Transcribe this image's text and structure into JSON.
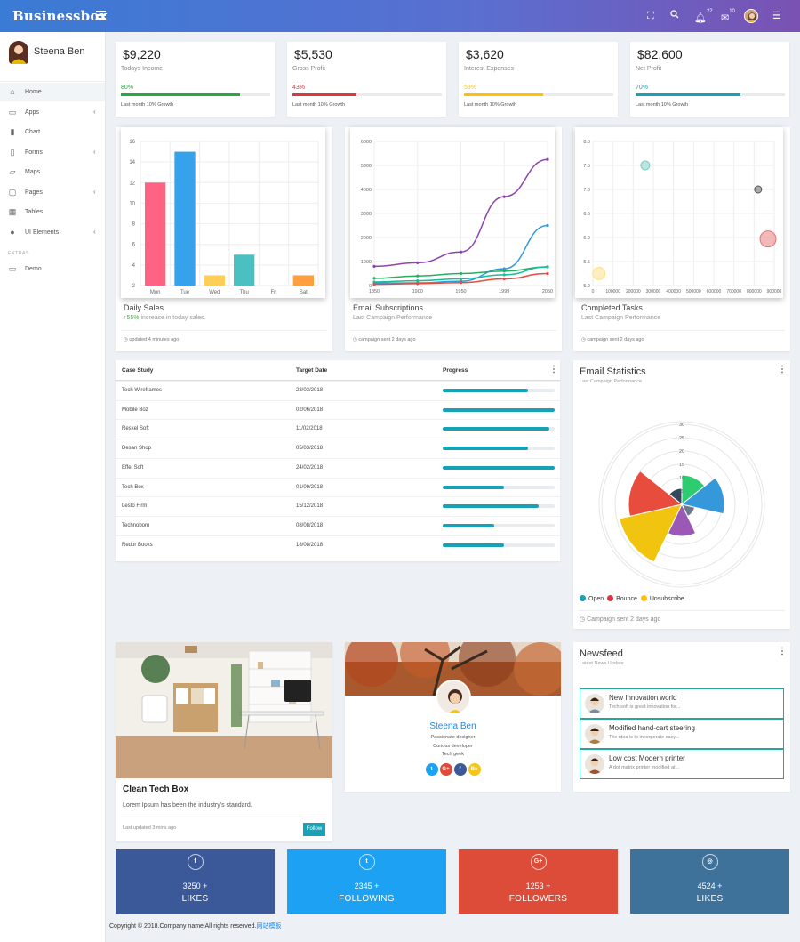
{
  "brand": "Businessbox",
  "topbar": {
    "notif_count": "22",
    "mail_count": "10"
  },
  "user": {
    "name": "Steena Ben"
  },
  "sidebar": {
    "items": [
      {
        "label": "Home",
        "icon": "home-icon",
        "glyph": "⌂",
        "chevron": false
      },
      {
        "label": "Apps",
        "icon": "apps-icon",
        "glyph": "▭",
        "chevron": true
      },
      {
        "label": "Chart",
        "icon": "chart-icon",
        "glyph": "▮",
        "chevron": false
      },
      {
        "label": "Forms",
        "icon": "forms-icon",
        "glyph": "▯",
        "chevron": true
      },
      {
        "label": "Maps",
        "icon": "maps-icon",
        "glyph": "▱",
        "chevron": false
      },
      {
        "label": "Pages",
        "icon": "pages-icon",
        "glyph": "▢",
        "chevron": true
      },
      {
        "label": "Tables",
        "icon": "tables-icon",
        "glyph": "▦",
        "chevron": false
      },
      {
        "label": "UI Elements",
        "icon": "ui-elements-icon",
        "glyph": "●",
        "chevron": true
      }
    ],
    "extras_label": "EXTRAS",
    "demo": "Demo"
  },
  "stats": [
    {
      "value": "$9,220",
      "label": "Todays Income",
      "pct": "80%",
      "fill": 0.8,
      "color": "#28a745",
      "note": "Last month 10% Growth"
    },
    {
      "value": "$5,530",
      "label": "Gross Profit",
      "pct": "43%",
      "fill": 0.43,
      "color": "#dc3545",
      "note": "Last month 10% Growth"
    },
    {
      "value": "$3,620",
      "label": "Interest Expenses",
      "pct": "53%",
      "fill": 0.53,
      "color": "#ffc107",
      "note": "Last month 10% Growth"
    },
    {
      "value": "$82,600",
      "label": "Net Profit",
      "pct": "70%",
      "fill": 0.7,
      "color": "#17a2b8",
      "note": "Last month 10% Growth"
    }
  ],
  "daily": {
    "title": "Daily Sales",
    "up": "55%",
    "sub": " increase in today sales.",
    "foot": "updated 4 minutes ago"
  },
  "email_sub": {
    "title": "Email Subscriptions",
    "sub": "Last Campaign Performance",
    "foot": "campaign sent 2 days ago"
  },
  "tasks": {
    "title": "Completed Tasks",
    "sub": "Last Campaign Performance",
    "foot": "campaign sent 2 days ago"
  },
  "chart_data": [
    {
      "type": "bar",
      "categories": [
        "Mon",
        "Tue",
        "Wed",
        "Thu",
        "Fri",
        "Sat"
      ],
      "values": [
        12,
        15,
        3,
        5,
        2,
        3
      ],
      "colors": [
        "#ff6384",
        "#36a2eb",
        "#ffce56",
        "#4bc0c0",
        "#9966ff",
        "#ff9f40"
      ],
      "ylim": [
        2,
        16
      ],
      "yticks": [
        "2",
        "4",
        "6",
        "8",
        "10",
        "12",
        "14",
        "16"
      ],
      "xlabel": "",
      "ylabel": "",
      "title": ""
    },
    {
      "type": "line",
      "x": [
        1850,
        1900,
        1950,
        1999,
        2050
      ],
      "xticks": [
        "1850",
        "1900",
        "1950",
        "1999",
        "2050"
      ],
      "ylim": [
        0,
        6000
      ],
      "yticks": [
        "0",
        "1000",
        "2000",
        "3000",
        "4000",
        "5000",
        "6000"
      ],
      "series": [
        {
          "values": [
            800,
            950,
            1400,
            3700,
            5250
          ],
          "color": "#8e44ad"
        },
        {
          "values": [
            100,
            110,
            180,
            700,
            2500
          ],
          "color": "#3498db"
        },
        {
          "values": [
            300,
            400,
            500,
            600,
            780
          ],
          "color": "#27ae60"
        },
        {
          "values": [
            150,
            200,
            280,
            450,
            780
          ],
          "color": "#1abc9c"
        },
        {
          "values": [
            50,
            80,
            120,
            280,
            500
          ],
          "color": "#e74c3c"
        }
      ]
    },
    {
      "type": "scatter",
      "xlim": [
        0,
        900000
      ],
      "ylim": [
        5.0,
        8.0
      ],
      "xticks": [
        "0",
        "100000",
        "200000",
        "300000",
        "400000",
        "500000",
        "600000",
        "700000",
        "800000",
        "900000"
      ],
      "yticks": [
        "5.0",
        "5.5",
        "6.0",
        "6.5",
        "7.0",
        "7.5",
        "8.0"
      ],
      "points": [
        {
          "x": 260000,
          "y": 7.5,
          "r": 5,
          "color": "#80cbc4"
        },
        {
          "x": 820000,
          "y": 7.0,
          "r": 4,
          "color": "#555555"
        },
        {
          "x": 920000,
          "y": 5.97,
          "r": 9,
          "color": "#e57373"
        },
        {
          "x": 30000,
          "y": 5.25,
          "r": 7,
          "color": "#ffe082"
        }
      ]
    },
    {
      "type": "polarArea",
      "labels": [
        "Open",
        "Bounce",
        "Unsubscribe"
      ],
      "rticks": [
        "5",
        "10",
        "15",
        "20",
        "25",
        "30"
      ],
      "rmax": 30,
      "slices": [
        {
          "value": 11,
          "color": "#2ecc71"
        },
        {
          "value": 16,
          "color": "#3498db"
        },
        {
          "value": 5,
          "color": "#6c7a89"
        },
        {
          "value": 12,
          "color": "#9b59b6"
        },
        {
          "value": 24,
          "color": "#f1c40f"
        },
        {
          "value": 20,
          "color": "#e74c3c"
        },
        {
          "value": 6,
          "color": "#34495e"
        }
      ]
    }
  ],
  "table": {
    "headers": [
      "Case Study",
      "Target Date",
      "Progress"
    ],
    "rows": [
      {
        "name": "Tech Wireframes",
        "date": "23/03/2018",
        "progress": 0.76
      },
      {
        "name": "Mobile Boz",
        "date": "02/06/2018",
        "progress": 1.0
      },
      {
        "name": "Reskel Soft",
        "date": "11/02/2018",
        "progress": 0.95
      },
      {
        "name": "Desan Shop",
        "date": "05/03/2018",
        "progress": 0.76
      },
      {
        "name": "Effel Soft",
        "date": "24/02/2018",
        "progress": 1.0
      },
      {
        "name": "Tech Box",
        "date": "01/09/2018",
        "progress": 0.55
      },
      {
        "name": "Lesto Firm",
        "date": "15/12/2018",
        "progress": 0.86
      },
      {
        "name": "Technoborn",
        "date": "08/08/2018",
        "progress": 0.46
      },
      {
        "name": "Redor Books",
        "date": "18/08/2018",
        "progress": 0.55
      }
    ]
  },
  "email_stats": {
    "title": "Email Statistics",
    "sub": "Last Campaign Performance",
    "foot": "Campaign sent 2 days ago",
    "legend": [
      {
        "label": "Open",
        "color": "#17a2b8"
      },
      {
        "label": "Bounce",
        "color": "#dc3545"
      },
      {
        "label": "Unsubscribe",
        "color": "#ffc107"
      }
    ]
  },
  "blog": {
    "title": "Clean Tech Box",
    "text": "Lorem Ipsum has been the industry's standard.",
    "foot": "Last updated 3 mins ago",
    "button": "Follow"
  },
  "profile": {
    "name": "Steena Ben",
    "lines": [
      "Passionate designer",
      "Curious developer",
      "Tech geek"
    ],
    "social": [
      {
        "icon": "twitter-icon",
        "glyph": "t",
        "color": "#1da1f2"
      },
      {
        "icon": "google-plus-icon",
        "glyph": "G+",
        "color": "#dd4b39"
      },
      {
        "icon": "facebook-icon",
        "glyph": "f",
        "color": "#3b5998"
      },
      {
        "icon": "behance-icon",
        "glyph": "Be",
        "color": "#f5c518"
      }
    ]
  },
  "newsfeed": {
    "title": "Newsfeed",
    "sub": "Latest News Update",
    "items": [
      {
        "title": "New Innovation world",
        "desc": "Tech soft is great innovation for..."
      },
      {
        "title": "Modified hand-cart steering",
        "desc": "The idea is to incorporate easy..."
      },
      {
        "title": "Low cost Modern printer",
        "desc": "A dot matrix printer modified at..."
      }
    ]
  },
  "socials": [
    {
      "icon": "facebook-icon",
      "glyph": "f",
      "num": "3250 +",
      "label": "LIKES",
      "color": "#3b5998"
    },
    {
      "icon": "twitter-icon",
      "glyph": "t",
      "num": "2345 +",
      "label": "FOLLOWING",
      "color": "#1da1f2"
    },
    {
      "icon": "google-plus-icon",
      "glyph": "G+",
      "num": "1253 +",
      "label": "FOLLOWERS",
      "color": "#dd4b39"
    },
    {
      "icon": "instagram-icon",
      "glyph": "◎",
      "num": "4524 +",
      "label": "LIKES",
      "color": "#3f729b"
    }
  ],
  "footer": {
    "text": "Copyright © 2018.Company name All rights reserved.",
    "link": "网站模板"
  }
}
